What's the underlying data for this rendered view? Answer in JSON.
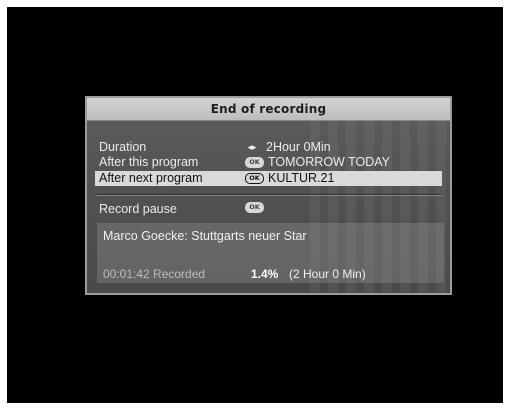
{
  "dialog": {
    "title": "End of recording",
    "rows": [
      {
        "label": "Duration",
        "icon": "arrows-left-right-icon",
        "value": "2Hour 0Min"
      },
      {
        "label": "After this program",
        "icon": "ok-button-icon",
        "icon_text": "OK",
        "value": "TOMORROW TODAY"
      },
      {
        "label": "After next program",
        "icon": "ok-button-icon",
        "icon_text": "OK",
        "value": "KULTUR.21",
        "selected": true
      },
      {
        "label": "Record pause",
        "icon": "ok-button-icon",
        "icon_text": "OK",
        "value": ""
      }
    ],
    "program_title": "Marco Goecke: Stuttgarts neuer Star",
    "status": {
      "elapsed": "00:01:42 Recorded",
      "percent": "1.4%",
      "length": "(2 Hour 0 Min)"
    }
  },
  "colors": {
    "screen_background": "#000000",
    "panel_background": "#555555",
    "title_bar": "#c8c8c8",
    "selection": "#d9d9d9"
  }
}
